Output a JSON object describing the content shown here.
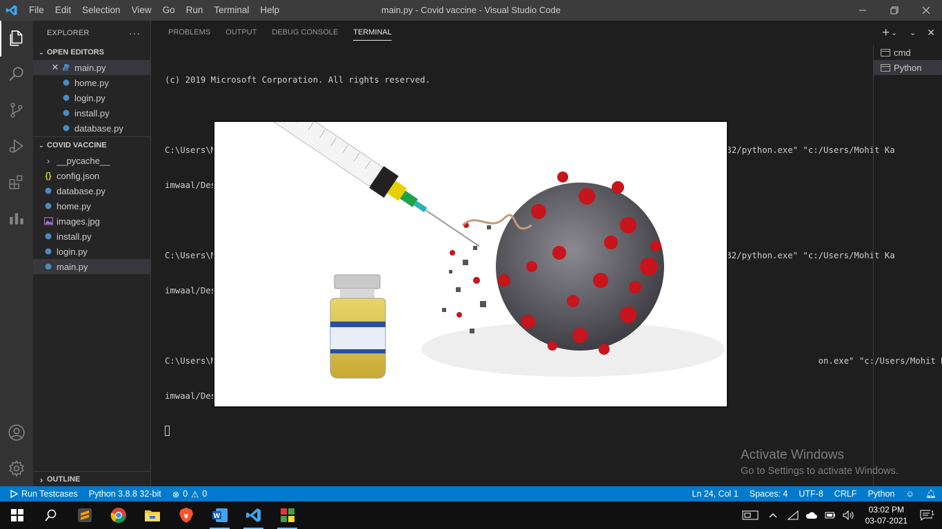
{
  "window": {
    "title": "main.py - Covid vaccine - Visual Studio Code",
    "menu": [
      "File",
      "Edit",
      "Selection",
      "View",
      "Go",
      "Run",
      "Terminal",
      "Help"
    ]
  },
  "sidebar": {
    "header": "EXPLORER",
    "open_editors": {
      "title": "OPEN EDITORS",
      "items": [
        {
          "label": "main.py",
          "icon": "python-file-icon",
          "active": true
        },
        {
          "label": "home.py",
          "icon": "python-file-icon"
        },
        {
          "label": "login.py",
          "icon": "python-file-icon"
        },
        {
          "label": "install.py",
          "icon": "python-file-icon"
        },
        {
          "label": "database.py",
          "icon": "python-file-icon"
        }
      ]
    },
    "project": {
      "title": "COVID VACCINE",
      "items": [
        {
          "label": "__pycache__",
          "icon": "folder-chevron-icon"
        },
        {
          "label": "config.json",
          "icon": "json-file-icon"
        },
        {
          "label": "database.py",
          "icon": "python-file-icon"
        },
        {
          "label": "home.py",
          "icon": "python-file-icon"
        },
        {
          "label": "images.jpg",
          "icon": "image-file-icon"
        },
        {
          "label": "install.py",
          "icon": "python-file-icon"
        },
        {
          "label": "login.py",
          "icon": "python-file-icon"
        },
        {
          "label": "main.py",
          "icon": "python-file-icon",
          "selected": true
        }
      ]
    },
    "outline": "OUTLINE"
  },
  "panel": {
    "tabs": [
      "PROBLEMS",
      "OUTPUT",
      "DEBUG CONSOLE",
      "TERMINAL"
    ],
    "active_tab": "TERMINAL",
    "terminal_lines": [
      "(c) 2019 Microsoft Corporation. All rights reserved.",
      "",
      "C:\\Users\\Mohit Kaimwaal\\Desktop\\Covid vaccine>\"C:/Users/Mohit Kaimwaal/AppData/Local/Programs/Python/Python38-32/python.exe\" \"c:/Users/Mohit Ka",
      "imwaal/Desktop/Covid vaccine/main.py\"",
      "",
      "C:\\Users\\Mohit Kaimwaal\\Desktop\\Covid vaccine>\"C:/Users/Mohit Kaimwaal/AppData/Local/Programs/Python/Python38-32/python.exe\" \"c:/Users/Mohit Ka",
      "imwaal/Des",
      "",
      "C:\\Users\\M                                                                                                                      on.exe\" \"c:/Users/Mohit Ka",
      "imwaal/Des"
    ],
    "terminals": [
      {
        "label": "cmd"
      },
      {
        "label": "Python",
        "selected": true
      }
    ]
  },
  "watermark": {
    "line1": "Activate Windows",
    "line2": "Go to Settings to activate Windows."
  },
  "statusbar": {
    "run": "Run Testcases",
    "python": "Python 3.8.8 32-bit",
    "errors": "0",
    "warnings": "0",
    "position": "Ln 24, Col 1",
    "spaces": "Spaces: 4",
    "encoding": "UTF-8",
    "eol": "CRLF",
    "language": "Python"
  },
  "taskbar": {
    "time": "03:02 PM",
    "date": "03-07-2021",
    "notifications": "1"
  },
  "colors": {
    "accent": "#007acc",
    "titlebar": "#3c3c3c",
    "activitybar": "#333333",
    "sidebar": "#252526",
    "editor": "#1e1e1e"
  }
}
